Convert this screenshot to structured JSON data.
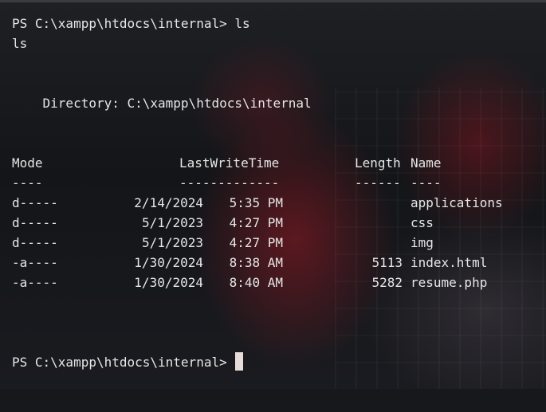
{
  "terminal": {
    "prompt_command": "PS C:\\xampp\\htdocs\\internal> ls",
    "echo": "ls",
    "directory_line": "    Directory: C:\\xampp\\htdocs\\internal",
    "headers": {
      "mode": "Mode",
      "lastwritetime": "LastWriteTime",
      "length": "Length",
      "name": "Name"
    },
    "separators": {
      "mode": "----",
      "lastwritetime": "-------------",
      "length": "------",
      "name": "----"
    },
    "rows": [
      {
        "mode": "d-----",
        "date": "2/14/2024",
        "time": "5:35 PM",
        "length": "",
        "name": "applications"
      },
      {
        "mode": "d-----",
        "date": "5/1/2023",
        "time": "4:27 PM",
        "length": "",
        "name": "css"
      },
      {
        "mode": "d-----",
        "date": "5/1/2023",
        "time": "4:27 PM",
        "length": "",
        "name": "img"
      },
      {
        "mode": "-a----",
        "date": "1/30/2024",
        "time": "8:38 AM",
        "length": "5113",
        "name": "index.html"
      },
      {
        "mode": "-a----",
        "date": "1/30/2024",
        "time": "8:40 AM",
        "length": "5282",
        "name": "resume.php"
      }
    ],
    "final_prompt": "PS C:\\xampp\\htdocs\\internal>"
  }
}
